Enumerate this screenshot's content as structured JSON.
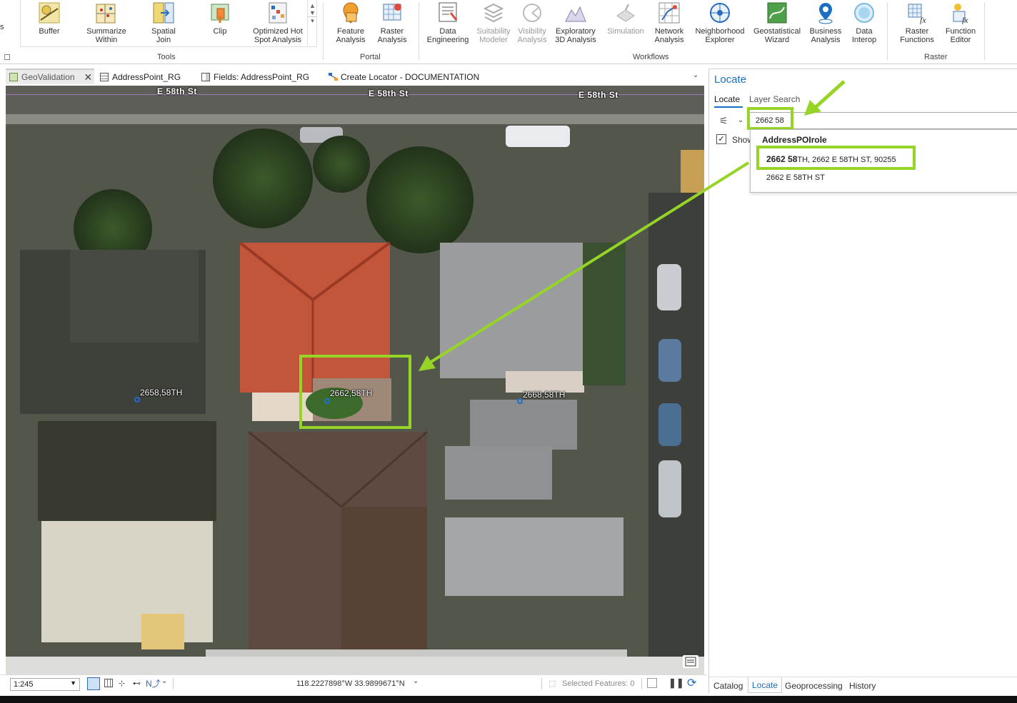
{
  "ribbon": {
    "tools_group": {
      "label": "Tools",
      "buttons": [
        {
          "label": "Buffer",
          "icon": "buffer-icon"
        },
        {
          "label": "Summarize\nWithin",
          "icon": "summarize-within-icon"
        },
        {
          "label": "Spatial\nJoin",
          "icon": "spatial-join-icon"
        },
        {
          "label": "Clip",
          "icon": "clip-icon"
        },
        {
          "label": "Optimized Hot\nSpot Analysis",
          "icon": "hot-spot-icon"
        }
      ]
    },
    "portal_group": {
      "label": "Portal",
      "buttons": [
        {
          "label": "Feature\nAnalysis",
          "icon": "feature-analysis-icon"
        },
        {
          "label": "Raster\nAnalysis",
          "icon": "raster-analysis-icon"
        }
      ]
    },
    "workflows_group": {
      "label": "Workflows",
      "buttons": [
        {
          "label": "Data\nEngineering",
          "icon": "data-engineering-icon"
        },
        {
          "label": "Suitability\nModeler",
          "icon": "suitability-icon"
        },
        {
          "label": "Visibility\nAnalysis",
          "icon": "visibility-icon"
        },
        {
          "label": "Exploratory\n3D Analysis",
          "icon": "exploratory-3d-icon"
        },
        {
          "label": "Simulation",
          "icon": "simulation-icon"
        },
        {
          "label": "Network\nAnalysis",
          "icon": "network-icon"
        },
        {
          "label": "Neighborhood\nExplorer",
          "icon": "neighborhood-icon"
        },
        {
          "label": "Geostatistical\nWizard",
          "icon": "geostat-icon"
        },
        {
          "label": "Business\nAnalysis",
          "icon": "business-icon"
        },
        {
          "label": "Data\nInterop",
          "icon": "interop-icon"
        }
      ]
    },
    "raster_group": {
      "label": "Raster",
      "buttons": [
        {
          "label": "Raster\nFunctions",
          "icon": "raster-functions-icon"
        },
        {
          "label": "Function\nEditor",
          "icon": "function-editor-icon"
        }
      ]
    }
  },
  "view_tabs": [
    {
      "label": "GeoValidation",
      "icon": "map-icon",
      "active": true
    },
    {
      "label": "AddressPoint_RG",
      "icon": "table-icon"
    },
    {
      "label": "Fields: AddressPoint_RG",
      "icon": "fields-icon"
    },
    {
      "label": "Create Locator - DOCUMENTATION",
      "icon": "model-icon"
    }
  ],
  "map": {
    "streets": [
      "E 58th St",
      "E 58th St",
      "E 58th St"
    ],
    "address_labels": [
      "2658,58TH",
      "2662,58TH",
      "2668,58TH"
    ]
  },
  "status": {
    "scale": "1:245",
    "coordinates": "118.2227898°W 33.9899671°N",
    "selected_features": "Selected Features: 0"
  },
  "locate_pane": {
    "title": "Locate",
    "tabs": [
      "Locate",
      "Layer Search"
    ],
    "search_value": "2662 58",
    "show_checkbox_label": "Show",
    "suggestion_group": "AddressPOIrole",
    "suggestions": [
      {
        "bold": "2662 58",
        "rest": "TH, 2662 E 58TH ST, 90255"
      },
      {
        "bold": "",
        "rest": "2662 E 58TH ST"
      }
    ]
  },
  "bottom_tabs": [
    "Catalog",
    "Locate",
    "Geoprocessing",
    "History"
  ],
  "colors": {
    "highlight": "#96d428",
    "accent": "#1a6fc4"
  }
}
